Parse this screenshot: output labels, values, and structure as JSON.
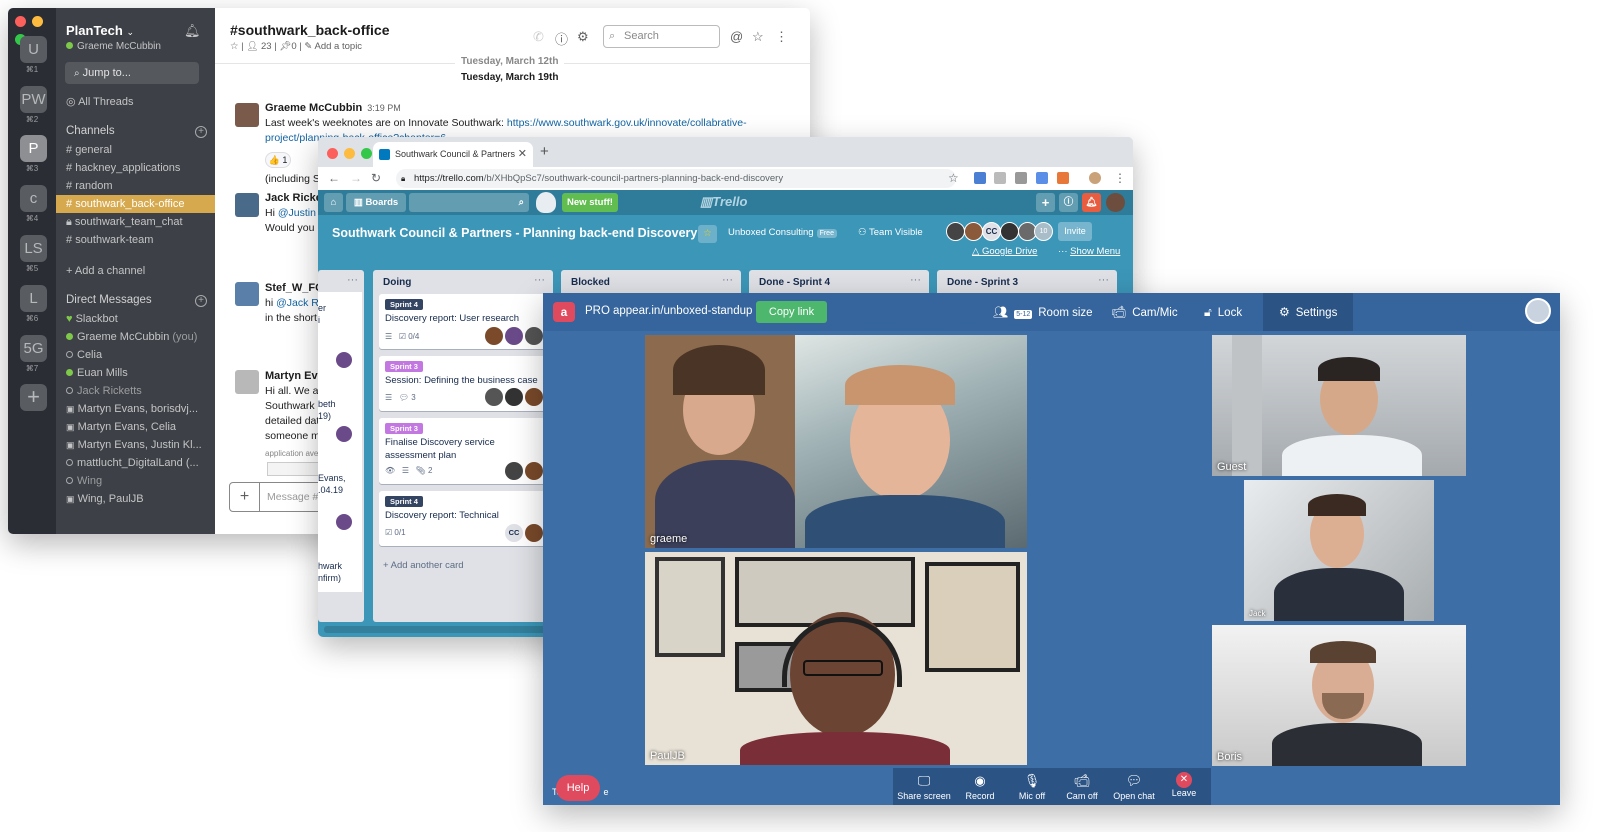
{
  "slack": {
    "workspaces": [
      {
        "initial": "U",
        "shortcut": "⌘1"
      },
      {
        "initial": "PW",
        "shortcut": "⌘2"
      },
      {
        "initial": "P",
        "shortcut": "⌘3"
      },
      {
        "initial": "c",
        "shortcut": "⌘4"
      },
      {
        "initial": "LS",
        "shortcut": "⌘5"
      },
      {
        "initial": "L",
        "shortcut": "⌘6"
      },
      {
        "initial": "5G",
        "shortcut": "⌘7"
      }
    ],
    "team_name": "PlanTech",
    "current_user": "Graeme McCubbin",
    "jump_to": "Jump to...",
    "all_threads": "All Threads",
    "channels_heading": "Channels",
    "channels": [
      "general",
      "hackney_applications",
      "random",
      "southwark_back-office",
      "southwark_team_chat",
      "southwark-team"
    ],
    "add_channel": "Add a channel",
    "dm_heading": "Direct Messages",
    "dms": [
      "Slackbot",
      "Graeme McCubbin",
      "Celia",
      "Euan Mills",
      "Jack Ricketts",
      "Martyn Evans, borisdvj...",
      "Martyn Evans, Celia",
      "Martyn Evans, Justin Kl...",
      "mattlucht_DigitalLand (...",
      "Wing",
      "Wing, PaulJB"
    ],
    "you_suffix": "(you)",
    "channel_title": "#southwark_back-office",
    "channel_members": "23",
    "channel_pins": "0",
    "add_topic": "Add a topic",
    "search_placeholder": "Search",
    "dates": [
      "Tuesday, March 12th",
      "Tuesday, March 19th"
    ],
    "messages": [
      {
        "author": "Graeme McCubbin",
        "time": "3:19 PM",
        "line1": "Last week's weeknotes are on Innovate Southwark: ",
        "link1": "https://www.southwark.gov.uk/innovate/collabrative-",
        "link2": "project/planning-back-office?chapter=6"
      },
      {
        "author": "Jack Ricketts",
        "line1": "Hi ",
        "mention": "@Justin Kl",
        "line2": "Would you ha"
      },
      {
        "author": "Stef_W_FCC",
        "line1": "hi ",
        "mention": "@Jack Rick",
        "line2": "in the short t"
      },
      {
        "author": "Martyn Evans",
        "lines": [
          "Hi all. We are",
          "Southwark da",
          "detailed data,",
          "someone mig"
        ],
        "footnote": "application avera"
      }
    ],
    "reaction": "👍 1",
    "including": "(including Sho",
    "composer_placeholder": "Message #so"
  },
  "trello": {
    "tab_title": "Southwark Council & Partners",
    "url_host": "https://trello.com",
    "url_path": "/b/XHbQpSc7/southwark-council-partners-planning-back-end-discovery",
    "boards_label": "Boards",
    "new_stuff": "New stuff!",
    "logo": "Trello",
    "board_title": "Southwark Council & Partners - Planning back-end Discovery",
    "team": "Unboxed Consulting",
    "plan": "Free",
    "visibility": "Team Visible",
    "member_initials": "CC",
    "member_count": "10",
    "invite": "Invite",
    "google_drive": "Google Drive",
    "show_menu": "Show Menu",
    "lists": [
      "Doing",
      "Blocked",
      "Done - Sprint 4",
      "Done - Sprint 3"
    ],
    "cards": [
      {
        "label": "Sprint 4",
        "title": "Discovery report: User research",
        "badge": "0/4"
      },
      {
        "label": "Sprint 3",
        "title": "Session: Defining the business case",
        "badge": "3"
      },
      {
        "label": "Sprint 3",
        "title": "Finalise Discovery service assessment plan",
        "badge": "2"
      },
      {
        "label": "Sprint 4",
        "title": "Discovery report: Technical",
        "badge": "0/1"
      }
    ],
    "card_initials": "CC",
    "add_card": "Add another card",
    "left_fragments": [
      "er",
      "i",
      "beth",
      "19)",
      "Evans,",
      ".04.19",
      "hwark",
      "nfirm)"
    ]
  },
  "appear": {
    "pro": "PRO",
    "room": "appear.in/unboxed-standup",
    "copy_link": "Copy link",
    "room_size_badge": "5-12",
    "room_size": "Room size",
    "cam_mic": "Cam/Mic",
    "lock": "Lock",
    "settings": "Settings",
    "participants": [
      "graeme",
      "PaulJB",
      "Guest",
      "Jack",
      "Boris"
    ],
    "toolbar": [
      "Share screen",
      "Record",
      "Mic off",
      "Cam off",
      "Open chat",
      "Leave"
    ],
    "help": "Help",
    "behind_help": "Te",
    "behind_help2": "e"
  },
  "colors": {
    "slack_sidebar": "#3d4046",
    "slack_active_channel": "#d6a94e",
    "trello_board": "#3c96b8",
    "trello_green": "#61bd4f",
    "appear_bg": "#3d6fa6",
    "appear_red": "#e04a5f"
  }
}
